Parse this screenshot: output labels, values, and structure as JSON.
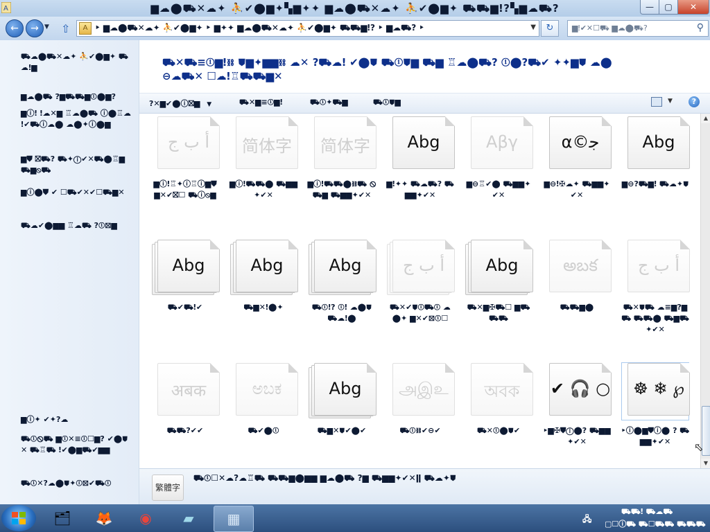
{
  "window": {
    "title": "▆☁⬤⛟✕☁✦ ⛹✔⬤▆✦▚▆✦✦ ▆☁⬤⛟✕☁✦ ⛹✔⬤▆✦ ⛟⛟▆ǃ?▚▆☁⛟?",
    "minimize_label": "—",
    "maximize_label": "▢",
    "close_label": "✕"
  },
  "nav": {
    "back_icon": "←",
    "forward_icon": "→",
    "dropdown_icon": "▼",
    "up_icon": "⇧",
    "address_icon_label": "A",
    "address_text": "‣ ▆☁⬤⛟✕☁✦ ⛹✔⬤▆✦  ‣ ▆✦✦ ▆☁⬤⛟✕☁✦ ⛹✔⬤▆✦ ⛟⛟▆ǃ?  ‣ ▆☁⛟?  ‣",
    "address_drop_icon": "▼",
    "refresh_icon": "↻",
    "search_placeholder": "▆ǃ✔✕☐⛟ ▆☁⬤⛟?",
    "search_icon": "⚲"
  },
  "left_pane": {
    "links": [
      "⛟☁⬤⛟✕☁✦ ⛹✔⬤▆✦ ⛟☁ǃ▆",
      "▆☁⬤⛟ ?▆⛟⛟▆ⓘ⬤▆?",
      "▆ⓘǃ ǃ☁✕▆ ♖☁⬤⛟ ⓘ⬤♖☁ǃ✔⛟ⓘ☁⬤ ☁⬤✦ⓘ⬤▆",
      "▆⛊ ⛝⛟? ⛟✦ⓘ✔✕⛟⬤♖▆ ⛟▆⦸⛟",
      "▆ⓘ⬤⛊ ✔ ☐⛟✔✕✔☐⛟▆✕",
      "⛟☁✔⬤▆▆ ♖☁⛟ ?ⓘ⛝▆",
      "▆ⓘ✦ ✔✦?☁",
      "⛟ⓘ⦸⛟ ▆ⓘ✕≡ⓘ☐▆? ✔⬤⛊ ✕ ⛟♖⛟ ǃ✔⬤▆⛟✔▆▆",
      "⛟ⓘ✕?☁⬤⛊✦ⓘ⛝✔⛟ⓘ"
    ]
  },
  "main": {
    "header": "⛟✕⛟≡ⓘ▆ǃ⛓ ⛊▆✦▆▆⛓ ☁✕ ?⛟☁ǃ ✔⬤⛊ ⛟ⓘ⛊▆ ⛟▆ ♖☁⬤⛟? ⓘ⬤?⛟✔ ✦✦▆⛊ ☁⬤ ⊖☁⛟✕ ☐☁ǃ♖⛟⛟▆✕",
    "toolbar": {
      "organize": "?✕▆✔⬤ⓘ⛝▆",
      "preview": "⛟✕▆≡ⓘ▆ǃ",
      "delete": "⛟ⓘ✦⛟▆",
      "hide": "⛟ⓘ⛊▆",
      "dropdown_icon": "▼",
      "help_icon": "?"
    },
    "fonts": [
      {
        "sample": "أ ب ج",
        "caption": "▆ⓘǃ♖✦ⓘ♖ⓘ▆⛊ ▆✕✔⛝☐ ⛟ⓘ⦸▆",
        "faded": true,
        "stack": 1
      },
      {
        "sample": "简体字",
        "caption": "▆ⓘǃ⛟⛟⬤ ⛟▆▆✦✔✕",
        "faded": true,
        "stack": 1
      },
      {
        "sample": "简体字",
        "caption": "▆ⓘǃ⛟⛟⬤⛓⛟ ⦸⛟▆ ⛟▆▆✦✔✕",
        "faded": true,
        "stack": 1
      },
      {
        "sample": "Abg",
        "caption": "▆ǃ✦✦ ⛟☁⛟? ⛟▆▆✦✔✕",
        "faded": false,
        "stack": 1
      },
      {
        "sample": "Aβγ",
        "caption": "▆⊖♖✔⬤ ⛟▆▆✦✔✕",
        "faded": true,
        "stack": 1
      },
      {
        "sample": "α©ﺟ",
        "caption": "▆⊖ǃ✠☁✦ ⛟▆▆✦✔✕",
        "faded": false,
        "stack": 1
      },
      {
        "sample": "Abg",
        "caption": "▆⊖?⛟▆ǃ ⛟☁✦⛊",
        "faded": false,
        "stack": 1
      },
      {
        "sample": "Abg",
        "caption": "⛟✔⛟ǃ✔",
        "faded": false,
        "stack": 3
      },
      {
        "sample": "Abg",
        "caption": "⛟▆✕ǃ⬤✦",
        "faded": false,
        "stack": 3
      },
      {
        "sample": "Abg",
        "caption": "⛟ⓘǃ? ⓘǃ ☁⬤⛊ ⛟☁ǃ⬤",
        "faded": false,
        "stack": 3
      },
      {
        "sample": "أ ب ج",
        "caption": "⛟✕✔⛊ⓘ⛟ⓘ ☁⬤✦ ▆✕✔⛝ⓘ☐",
        "faded": true,
        "stack": 3
      },
      {
        "sample": "Abg",
        "caption": "⛟✕▆✠⛟☐ ▆⛟ ⛟⛟",
        "faded": false,
        "stack": 3
      },
      {
        "sample": "అబక",
        "caption": "⛟⛟▆⬤",
        "faded": true,
        "stack": 1
      },
      {
        "sample": "أ ب ج",
        "caption": "⛟✕⛊⛟ ☁≡▆?▆⛟ ⛟⛟⬤ ⛟▆⛟✦✔✕",
        "faded": true,
        "stack": 1
      },
      {
        "sample": "अबक",
        "caption": "⛟⛟?✔✔",
        "faded": true,
        "stack": 1
      },
      {
        "sample": "ಅಬಕ",
        "caption": "⛟✔⬤ⓘ",
        "faded": true,
        "stack": 1
      },
      {
        "sample": "Abg",
        "caption": "⛟▆✕⛊✔⬤✔",
        "faded": false,
        "stack": 3
      },
      {
        "sample": "அஇஉ",
        "caption": "⛟ⓘ⛓✔⊖✔",
        "faded": true,
        "stack": 1
      },
      {
        "sample": "অবক",
        "caption": "⛟✕ⓘ⬤⛊✔",
        "faded": true,
        "stack": 1
      },
      {
        "sample": "✔ 🎧 ○",
        "caption": "‣▆✠⛊ⓘ⬤? ⛟▆▆✦✔✕",
        "faded": false,
        "stack": 1
      },
      {
        "sample": "☸ ❄ ℘",
        "caption": "‣ⓘ⬤▆⛊ⓘ⬤ ? ⛟▆▆✦✔✕",
        "faded": false,
        "stack": 1,
        "selected": true
      }
    ]
  },
  "scrollbar": {
    "up_icon": "▲",
    "down_icon": "▼"
  },
  "details": {
    "icon_text": "繁體字",
    "text": "⛟ⓘ☐✕☁?☁♖⛟ ⛟⛟▆⬤▆▆ ▆☁⬤⛟ ?▆ ⛟▆▆✦✔✕ǁ ⛟☁✦⛊"
  },
  "taskbar": {
    "apps": [
      {
        "icon": "🗂",
        "name": "explorer"
      },
      {
        "icon": "🦊",
        "name": "firefox"
      },
      {
        "icon": "◉",
        "name": "chrome"
      },
      {
        "icon": "▰",
        "name": "notes"
      },
      {
        "icon": "▦",
        "name": "control-panel"
      }
    ],
    "tray_line1": "⛟⛟ǃ ⛟☁⛟",
    "tray_line2": "▢☐ⓘ⛟ ⛟☐⛟⛟ ⛟⛟⛟",
    "network_icon": "🖧"
  },
  "colors": {
    "accent": "#0d2f8a",
    "title_bar": "#c9dcf0",
    "close": "#c7432b"
  }
}
